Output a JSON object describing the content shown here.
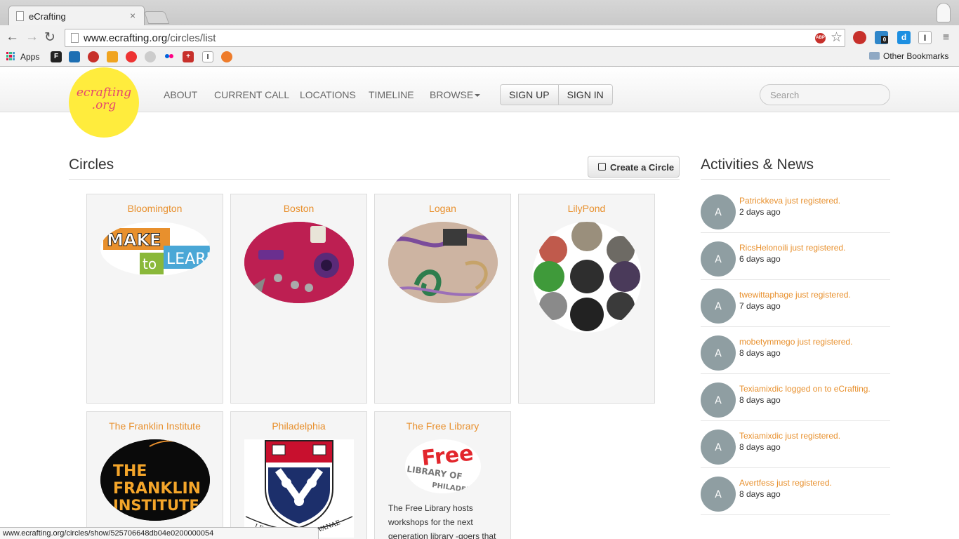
{
  "browser": {
    "tab_title": "eCrafting",
    "tab_close": "×",
    "url_host": "www.ecrafting.org",
    "url_path": "/circles/list",
    "back_glyph": "←",
    "forward_glyph": "→",
    "reload_glyph": "↻",
    "star_glyph": "☆",
    "abp_label": "ABP",
    "ext_badge_count": "0",
    "bookmarks_apps_label": "Apps",
    "other_bookmarks_label": "Other Bookmarks",
    "status_url": "www.ecrafting.org/circles/show/525706648db04e0200000054"
  },
  "site": {
    "logo_line1": "ecrafting",
    "logo_line2": ".org",
    "logo_color": "#ffec3d",
    "nav": {
      "about": "ABOUT",
      "current_call": "CURRENT CALL",
      "locations": "LOCATIONS",
      "timeline": "TIMELINE",
      "browse": "BROWSE"
    },
    "signup_label": "SIGN UP",
    "signin_label": "SIGN IN",
    "search_placeholder": "Search",
    "accent_color": "#e8902d"
  },
  "circles": {
    "heading": "Circles",
    "create_label": "Create a Circle",
    "items": [
      {
        "title": "Bloomington",
        "image": "make-to-learn-logo"
      },
      {
        "title": "Boston",
        "image": "lilypad-sewing-photo"
      },
      {
        "title": "Logan",
        "image": "embroidery-circuit-photo"
      },
      {
        "title": "LilyPond",
        "image": "lilypad-collage-photo"
      },
      {
        "title": "The Franklin Institute",
        "image": "franklin-institute-logo"
      },
      {
        "title": "Philadelphia",
        "image": "penn-shield-logo"
      },
      {
        "title": "The Free Library",
        "image": "free-library-logo",
        "description": "The Free Library hosts workshops for the next generation library -goers that"
      }
    ],
    "logo_text": {
      "make": "MAKE",
      "to": "to",
      "learn": "LEARN",
      "franklin": [
        "THE",
        "FRANKLIN",
        "INSTITUTE"
      ],
      "free": "Free",
      "library_of": "LIBRARY OF",
      "philadelphia": "PHILADELPHIA",
      "leges": "LEGES",
      "vanae": "VANAE"
    }
  },
  "activities": {
    "heading": "Activities & News",
    "items": [
      {
        "avatar": "A",
        "text": "Patrickkeva just registered.",
        "time": "2 days ago"
      },
      {
        "avatar": "A",
        "text": "RicsHelonoili just registered.",
        "time": "6 days ago"
      },
      {
        "avatar": "A",
        "text": "twewittaphage just registered.",
        "time": "7 days ago"
      },
      {
        "avatar": "A",
        "text": "mobetymmego just registered.",
        "time": "8 days ago"
      },
      {
        "avatar": "A",
        "text": "Texiamixdic logged on to eCrafting.",
        "time": "8 days ago"
      },
      {
        "avatar": "A",
        "text": "Texiamixdic just registered.",
        "time": "8 days ago"
      },
      {
        "avatar": "A",
        "text": "Avertfess just registered.",
        "time": "8 days ago"
      }
    ]
  }
}
